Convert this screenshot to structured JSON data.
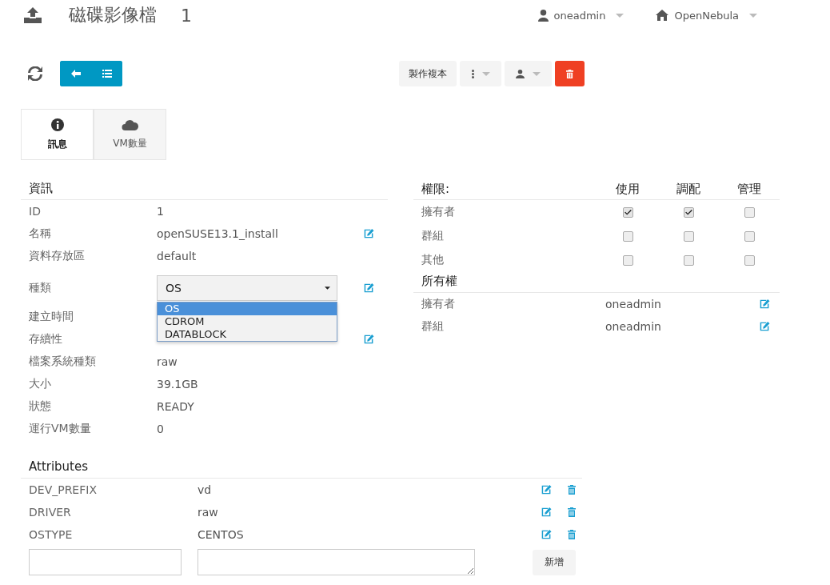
{
  "header": {
    "title": "磁碟影像檔",
    "id": "1",
    "user": "oneadmin",
    "zone": "OpenNebula"
  },
  "toolbar": {
    "clone_label": "製作複本"
  },
  "tabs": [
    {
      "label": "訊息",
      "selected": true
    },
    {
      "label": "VM數量",
      "selected": false
    }
  ],
  "info": {
    "title": "資訊",
    "rows": [
      {
        "kind": "text",
        "label": "ID",
        "value": "1",
        "editable": false
      },
      {
        "kind": "text",
        "label": "名稱",
        "value": "openSUSE13.1_install",
        "editable": true
      },
      {
        "kind": "text",
        "label": "資料存放區",
        "value": "default",
        "editable": false
      },
      {
        "kind": "select",
        "label": "種類",
        "value": "OS",
        "editable": true,
        "open": true,
        "options": [
          {
            "label": "OS",
            "selected": true
          },
          {
            "label": "CDROM",
            "selected": false
          },
          {
            "label": "DATABLOCK",
            "selected": false
          }
        ]
      },
      {
        "kind": "covered",
        "label": "建立時間",
        "editable": false
      },
      {
        "kind": "covered",
        "label": "存續性",
        "editable": true
      },
      {
        "kind": "text",
        "label": "檔案系統種類",
        "value": "raw",
        "editable": false
      },
      {
        "kind": "text",
        "label": "大小",
        "value": "39.1GB",
        "editable": false
      },
      {
        "kind": "text",
        "label": "狀態",
        "value": "READY",
        "editable": false
      },
      {
        "kind": "text",
        "label": "運行VM數量",
        "value": "0",
        "editable": false
      }
    ]
  },
  "permissions": {
    "title": "權限:",
    "columns": [
      "使用",
      "調配",
      "管理"
    ],
    "rows": [
      {
        "label": "擁有者",
        "checks": [
          {
            "checked": true
          },
          {
            "checked": true
          },
          {
            "checked": false
          }
        ]
      },
      {
        "label": "群組",
        "checks": [
          {
            "checked": false
          },
          {
            "checked": false
          },
          {
            "checked": false
          }
        ]
      },
      {
        "label": "其他",
        "checks": [
          {
            "checked": false
          },
          {
            "checked": false
          },
          {
            "checked": false
          }
        ]
      }
    ]
  },
  "ownership": {
    "title": "所有權",
    "rows": [
      {
        "label": "擁有者",
        "value": "oneadmin"
      },
      {
        "label": "群組",
        "value": "oneadmin"
      }
    ]
  },
  "attributes": {
    "title": "Attributes",
    "rows": [
      {
        "name": "DEV_PREFIX",
        "value": "vd"
      },
      {
        "name": "DRIVER",
        "value": "raw"
      },
      {
        "name": "OSTYPE",
        "value": "CENTOS"
      }
    ],
    "add_label": "新增"
  }
}
